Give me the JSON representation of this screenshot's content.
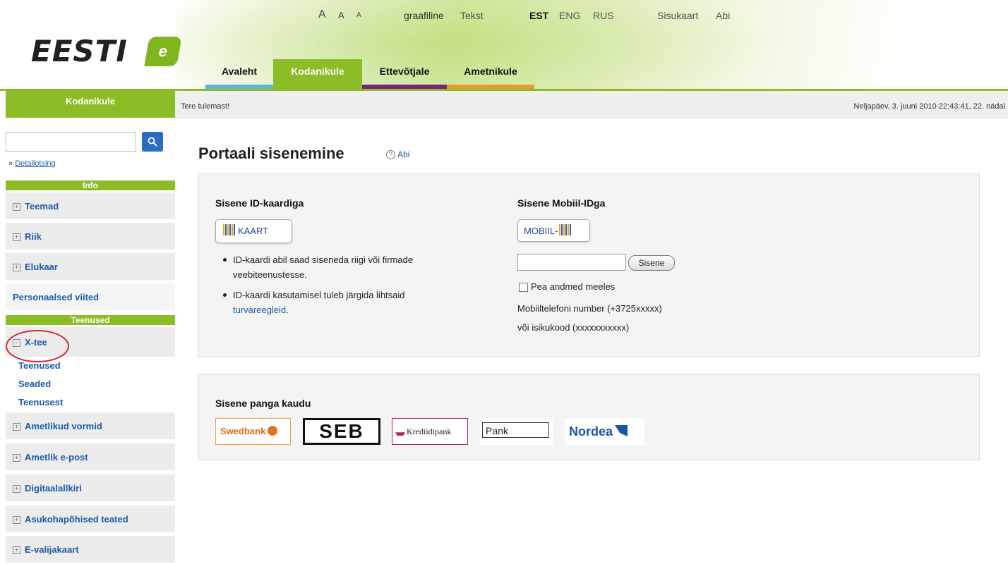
{
  "header": {
    "logo_text": "EESTI",
    "logo_mark": "e",
    "font_sizes": [
      "A",
      "A",
      "A"
    ],
    "view_modes": [
      "graafiline",
      "Tekst"
    ],
    "languages": [
      "EST",
      "ENG",
      "RUS"
    ],
    "utility_links": [
      "Sisukaart",
      "Abi"
    ],
    "tabs": [
      {
        "label": "Avaleht",
        "color": "#5db6d9"
      },
      {
        "label": "Kodanikule",
        "color": "#8cbd27"
      },
      {
        "label": "Ettevõtjale",
        "color": "#7d2180"
      },
      {
        "label": "Ametnikule",
        "color": "#eb9a2d"
      }
    ]
  },
  "sidebar": {
    "title": "Kodanikule",
    "detail_search_prefix": "»",
    "detail_search": "Detailotsing",
    "section_info": "Info",
    "info_items": [
      "Teemad",
      "Riik",
      "Elukaar"
    ],
    "personal": "Personaalsed viited",
    "section_services": "Teenused",
    "expanded_item": "X-tee",
    "sub_items": [
      "Teenused",
      "Seaded",
      "Teenusest"
    ],
    "service_items": [
      "Ametlikud vormid",
      "Ametlik e-post",
      "Digitaalallkiri",
      "Asukohapõhised teated",
      "E-valijakaart"
    ],
    "expand_symbol": "+",
    "collapse_symbol": "−"
  },
  "welcome": {
    "greeting": "Tere tulemast!",
    "datetime": "Neljapäev, 3. juuni 2010 22:43:41, 22. nädal"
  },
  "main": {
    "title": "Portaali sisenemine",
    "help_icon": "?",
    "help_label": "Abi",
    "id_card": {
      "heading": "Sisene ID-kaardiga",
      "button": "KAART",
      "bullet1": "ID-kaardi abil saad siseneda riigi või firmade veebiteenustesse.",
      "bullet2_text": "ID-kaardi kasutamisel tuleb järgida lihtsaid",
      "bullet2_link": "turvareegleid",
      "bullet2_end": "."
    },
    "mobile_id": {
      "heading": "Sisene Mobiil-IDga",
      "button": "MOBIIL-",
      "submit": "Sisene",
      "remember": "Pea andmed meeles",
      "hint1": "Mobiiltelefoni number (+3725xxxxx)",
      "hint2": "või isikukood (xxxxxxxxxxx)"
    },
    "bank": {
      "heading": "Sisene panga kaudu",
      "banks": [
        "Swedbank",
        "SEB",
        "Krediidipank",
        "Pank",
        "Nordea"
      ]
    }
  }
}
